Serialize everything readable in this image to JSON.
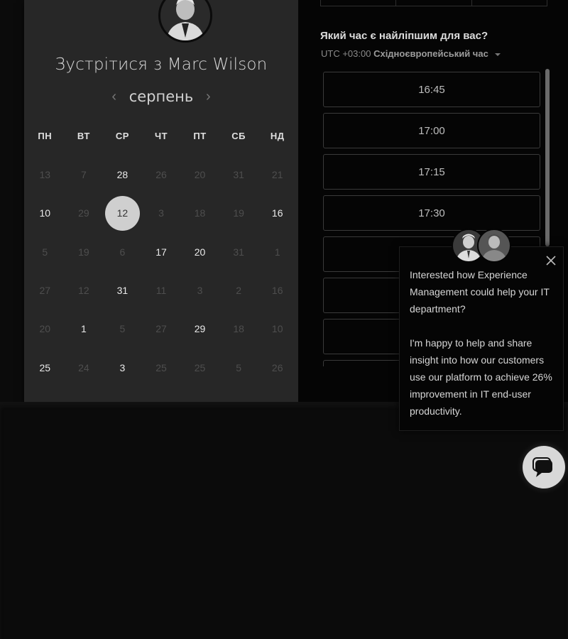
{
  "calendar": {
    "title": "Зустрітися з Marc Wilson",
    "month": "серпень",
    "prev_icon": "‹",
    "next_icon": "›",
    "weekdays": [
      "ПН",
      "ВТ",
      "СР",
      "ЧТ",
      "ПТ",
      "СБ",
      "НД"
    ],
    "days": [
      {
        "label": "13",
        "state": "disabled"
      },
      {
        "label": "7",
        "state": "disabled"
      },
      {
        "label": "28",
        "state": "available"
      },
      {
        "label": "26",
        "state": "disabled"
      },
      {
        "label": "20",
        "state": "disabled"
      },
      {
        "label": "31",
        "state": "disabled"
      },
      {
        "label": "21",
        "state": "disabled"
      },
      {
        "label": "10",
        "state": "available"
      },
      {
        "label": "29",
        "state": "disabled"
      },
      {
        "label": "12",
        "state": "selected"
      },
      {
        "label": "3",
        "state": "disabled"
      },
      {
        "label": "18",
        "state": "disabled"
      },
      {
        "label": "19",
        "state": "disabled"
      },
      {
        "label": "16",
        "state": "available"
      },
      {
        "label": "5",
        "state": "disabled"
      },
      {
        "label": "19",
        "state": "disabled"
      },
      {
        "label": "6",
        "state": "disabled"
      },
      {
        "label": "17",
        "state": "available"
      },
      {
        "label": "20",
        "state": "available"
      },
      {
        "label": "31",
        "state": "disabled"
      },
      {
        "label": "1",
        "state": "disabled"
      },
      {
        "label": "27",
        "state": "disabled"
      },
      {
        "label": "12",
        "state": "disabled"
      },
      {
        "label": "31",
        "state": "available"
      },
      {
        "label": "11",
        "state": "disabled"
      },
      {
        "label": "3",
        "state": "disabled"
      },
      {
        "label": "2",
        "state": "disabled"
      },
      {
        "label": "16",
        "state": "disabled"
      },
      {
        "label": "20",
        "state": "disabled"
      },
      {
        "label": "1",
        "state": "available"
      },
      {
        "label": "5",
        "state": "disabled"
      },
      {
        "label": "27",
        "state": "disabled"
      },
      {
        "label": "29",
        "state": "available"
      },
      {
        "label": "18",
        "state": "disabled"
      },
      {
        "label": "10",
        "state": "disabled"
      },
      {
        "label": "25",
        "state": "available"
      },
      {
        "label": "24",
        "state": "disabled"
      },
      {
        "label": "3",
        "state": "available"
      },
      {
        "label": "25",
        "state": "disabled"
      },
      {
        "label": "25",
        "state": "disabled"
      },
      {
        "label": "5",
        "state": "disabled"
      },
      {
        "label": "26",
        "state": "disabled"
      }
    ]
  },
  "time_picker": {
    "question": "Який час є найліпшим для вас?",
    "tz_offset": "UTC +03:00",
    "tz_name": "Східноєвропейський час",
    "slots": [
      "16:45",
      "17:00",
      "17:15",
      "17:30",
      "",
      "",
      "",
      ""
    ]
  },
  "chat": {
    "message_1": "Interested how Experience Management could help your IT department?",
    "message_2": "I'm happy to help and share insight into how our customers use our platform to achieve 26% improvement in IT end-user productivity.",
    "close_icon": "close-icon",
    "launcher_icon": "chat-bubble-icon"
  }
}
